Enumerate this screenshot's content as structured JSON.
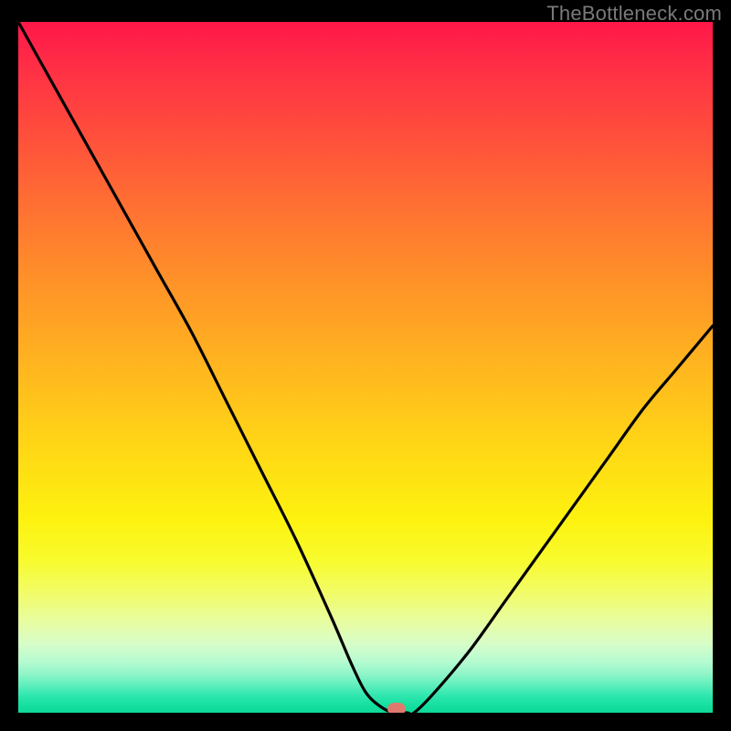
{
  "watermark": "TheBottleneck.com",
  "chart_data": {
    "type": "line",
    "title": "",
    "xlabel": "",
    "ylabel": "",
    "xlim": [
      0,
      100
    ],
    "ylim": [
      0,
      100
    ],
    "grid": false,
    "legend": false,
    "series": [
      {
        "name": "bottleneck-curve",
        "x": [
          0,
          5,
          10,
          15,
          20,
          25,
          30,
          35,
          40,
          45,
          48,
          50,
          52,
          54,
          56,
          57,
          60,
          65,
          70,
          75,
          80,
          85,
          90,
          95,
          100
        ],
        "y": [
          100,
          91,
          82,
          73,
          64,
          55,
          45,
          35,
          25,
          14,
          7,
          3,
          1,
          0,
          0,
          0,
          3,
          9,
          16,
          23,
          30,
          37,
          44,
          50,
          56
        ]
      }
    ],
    "optimum_marker": {
      "x": 54.5,
      "y": 0
    },
    "background_gradient": {
      "top": "#ff1749",
      "mid": "#ffe414",
      "bottom": "#0fd998"
    }
  }
}
